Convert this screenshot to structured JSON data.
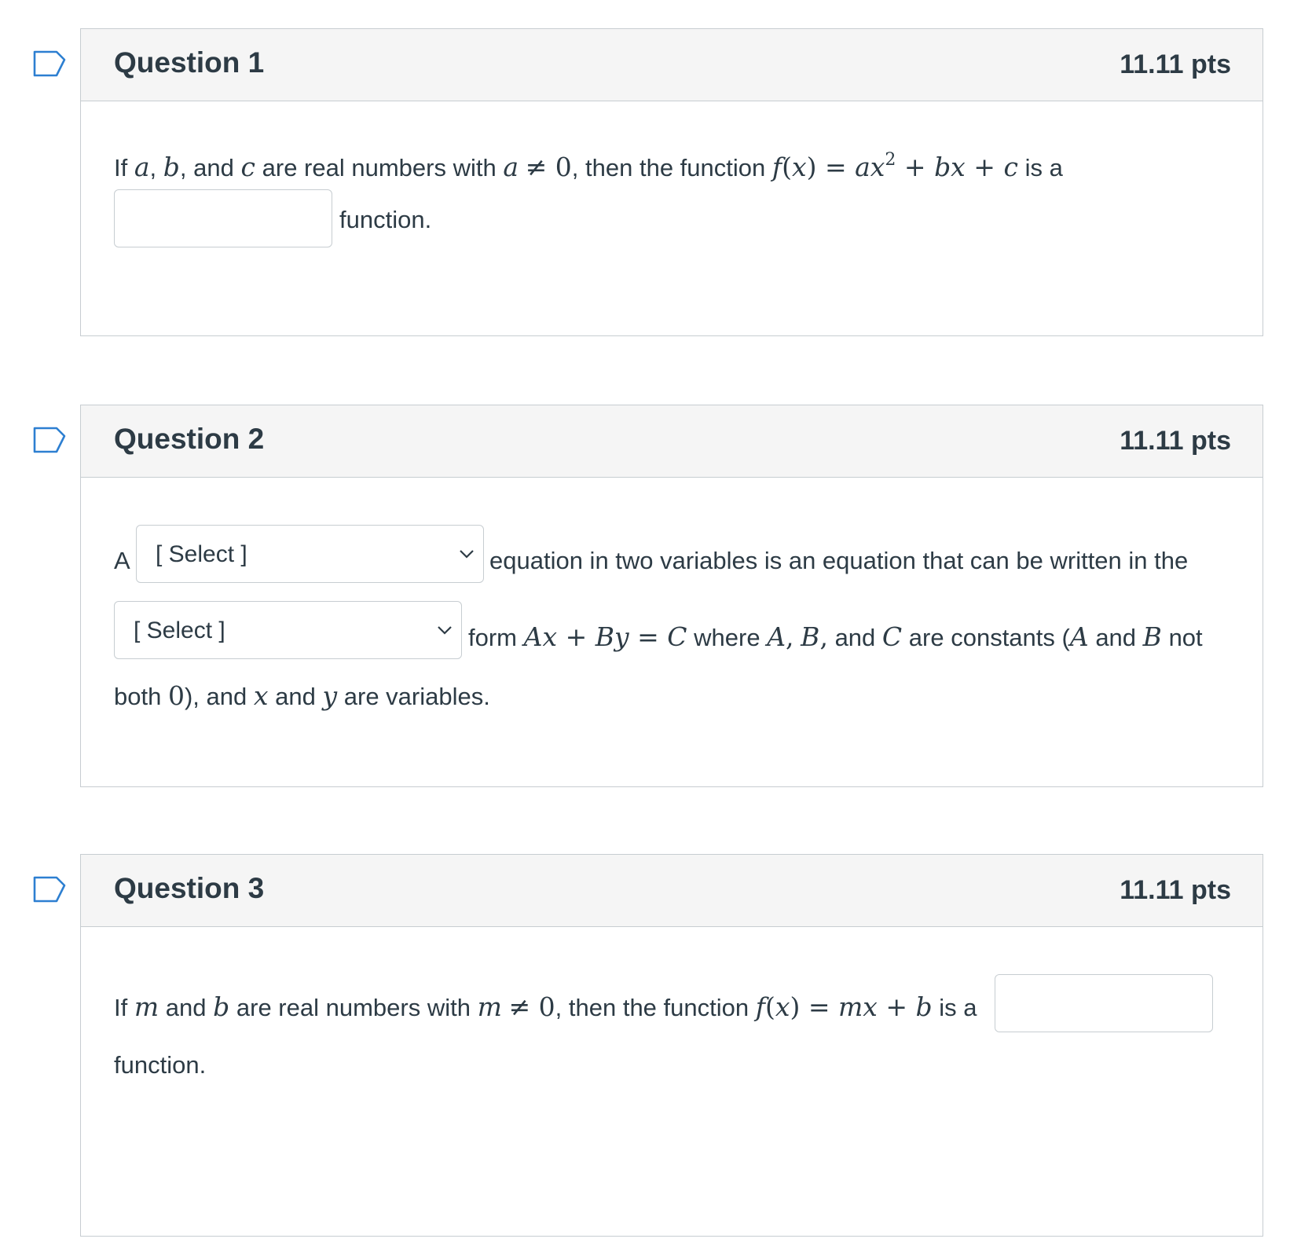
{
  "questions": [
    {
      "title": "Question 1",
      "points": "11.11 pts",
      "text_if": "If",
      "text_comma": ",",
      "text_and": "and",
      "text_are_real": "are real numbers with",
      "text_then": ", then the function",
      "text_is_a": "is a",
      "text_function": "function.",
      "answer_value": ""
    },
    {
      "title": "Question 2",
      "points": "11.11 pts",
      "text_a": "A",
      "select1_value": "[ Select ]",
      "text_equation": "equation in two variables is an equation that can be written in the",
      "select2_value": "[ Select ]",
      "text_form": "form",
      "text_where": "where",
      "text_and": "and",
      "text_are_constants": "are constants (",
      "text_not": "not",
      "text_both": "both",
      "text_and_x": "), and",
      "text_are_variables": "are variables."
    },
    {
      "title": "Question 3",
      "points": "11.11 pts",
      "text_if": "If",
      "text_and": "and",
      "text_are_real": "are real numbers with",
      "text_then": ", then the function",
      "text_is_a": "is a",
      "text_function": "function.",
      "answer_value": ""
    }
  ],
  "icons": {
    "flag": "bookmark-flag-icon",
    "chevron": "chevron-down-icon"
  },
  "colors": {
    "flag": "#2d7fd1",
    "border": "#c7cdd1",
    "header_bg": "#f5f5f5",
    "text": "#2d3b45"
  }
}
